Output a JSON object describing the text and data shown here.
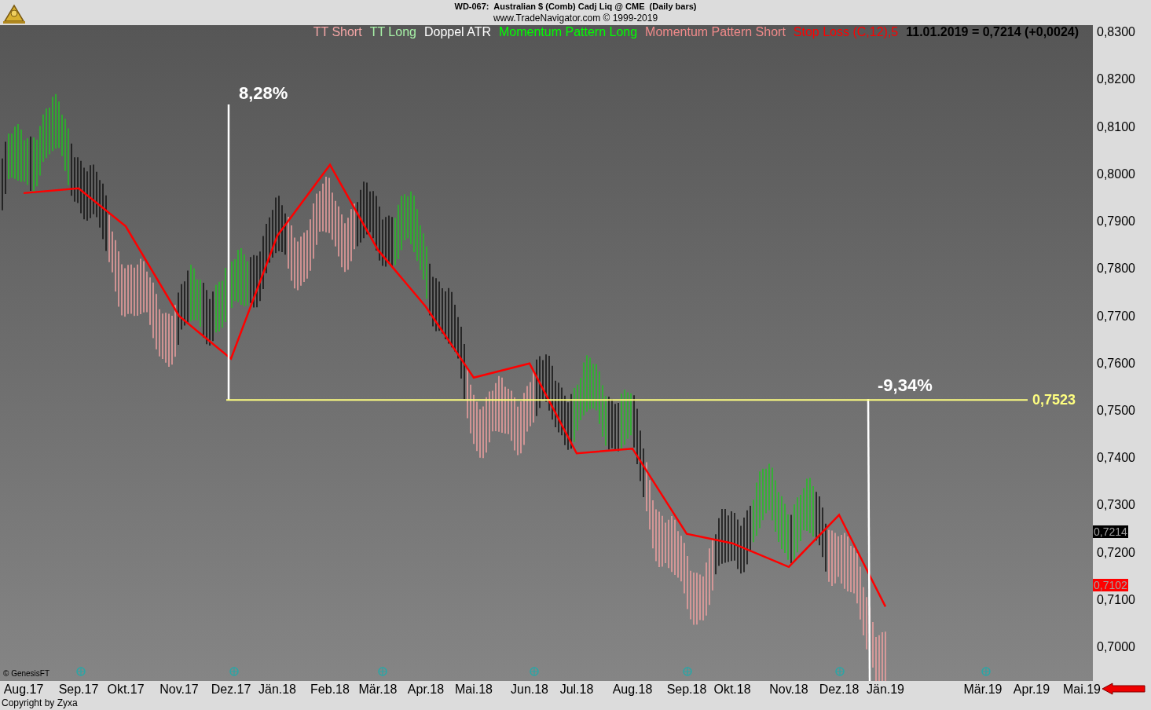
{
  "window": {
    "title": "WD-067:  Australian $ (Comb) Cadj Liq @ CME  (Daily bars)",
    "subtitle": "www.TradeNavigator.com © 1999-2019"
  },
  "legend": [
    {
      "text": "TT Short",
      "color": "#f4a6a6"
    },
    {
      "text": "TT Long",
      "color": "#a6f0a6"
    },
    {
      "text": "Doppel ATR",
      "color": "#ffffff"
    },
    {
      "text": "Momentum Pattern Long",
      "color": "#00ff00"
    },
    {
      "text": "Momentum Pattern Short",
      "color": "#f08a8a"
    }
  ],
  "quote": "11.01.2019 = 0,7214 (+0,0024)",
  "price_tags": [
    {
      "text": "0,7214",
      "color": "#000000"
    },
    {
      "text": "0,7102",
      "color": "#ff0000"
    }
  ],
  "plot_credit": "© GenesisFT",
  "annotations": [
    {
      "kind": "percent",
      "text": "8,28%"
    },
    {
      "kind": "percent",
      "text": "-9,34%"
    },
    {
      "kind": "level",
      "text": "0,7523",
      "color": "#ffff80"
    }
  ],
  "chart": {
    "chart_data": {
      "type": "line",
      "categories": [
        "Aug.17",
        "Sep.17",
        "Okt.17",
        "Nov.17",
        "Dez.17",
        "Jän.18",
        "Feb.18",
        "Mär.18",
        "Apr.18",
        "Mai.18",
        "Jun.18",
        "Jul.18",
        "Aug.18",
        "Sep.18",
        "Okt.18",
        "Nov.18",
        "Dez.18",
        "Jän.19",
        "Mär.19",
        "Apr.19",
        "Mai.19"
      ],
      "series": [
        {
          "name": "Stop Loss (C,12),5",
          "color": "#ff0000",
          "values": [
            0.796,
            0.797,
            0.789,
            0.77,
            0.761,
            0.787,
            0.802,
            0.784,
            0.772,
            0.757,
            0.76,
            0.741,
            0.742,
            0.724,
            0.722,
            0.717,
            0.728,
            0.7086,
            null,
            null,
            null
          ]
        }
      ],
      "ylim": [
        0.6929,
        0.8315
      ],
      "yticks": [
        {
          "value": 0.83,
          "label": "0,8300"
        },
        {
          "value": 0.82,
          "label": "0,8200"
        },
        {
          "value": 0.81,
          "label": "0,8100"
        },
        {
          "value": 0.8,
          "label": "0,8000"
        },
        {
          "value": 0.79,
          "label": "0,7900"
        },
        {
          "value": 0.78,
          "label": "0,7800"
        },
        {
          "value": 0.77,
          "label": "0,7700"
        },
        {
          "value": 0.76,
          "label": "0,7600"
        },
        {
          "value": 0.75,
          "label": "0,7500"
        },
        {
          "value": 0.74,
          "label": "0,7400"
        },
        {
          "value": 0.73,
          "label": "0,7300"
        },
        {
          "value": 0.72,
          "label": "0,7200"
        },
        {
          "value": 0.71,
          "label": "0,7100"
        },
        {
          "value": 0.7,
          "label": "0,7000"
        }
      ]
    }
  },
  "copyright": "Copyright by Zyxa"
}
